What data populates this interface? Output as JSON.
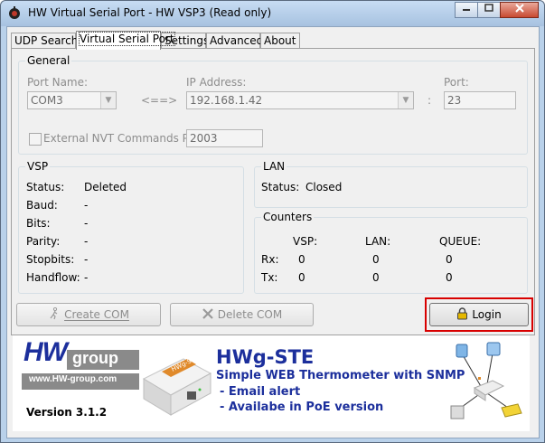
{
  "window": {
    "title": "HW Virtual Serial Port - HW VSP3 (Read only)"
  },
  "tabs": [
    {
      "label": "UDP Search"
    },
    {
      "label": "Virtual Serial Port",
      "active": true
    },
    {
      "label": "Settings"
    },
    {
      "label": "Advanced"
    },
    {
      "label": "About"
    }
  ],
  "general": {
    "title": "General",
    "port_name_label": "Port Name:",
    "port_name_value": "COM3",
    "arrow": "<==>",
    "ip_label": "IP Address:",
    "ip_value": "192.168.1.42",
    "colon": ":",
    "port_label": "Port:",
    "port_value": "23",
    "nvt_label": "External NVT Commands Port:",
    "nvt_value": "2003"
  },
  "vsp": {
    "title": "VSP",
    "rows": [
      {
        "label": "Status:",
        "value": "Deleted"
      },
      {
        "label": "Baud:",
        "value": "-"
      },
      {
        "label": "Bits:",
        "value": "-"
      },
      {
        "label": "Parity:",
        "value": "-"
      },
      {
        "label": "Stopbits:",
        "value": "-"
      },
      {
        "label": "Handflow:",
        "value": "-"
      }
    ]
  },
  "lan": {
    "title": "LAN",
    "status_label": "Status:",
    "status_value": "Closed"
  },
  "counters": {
    "title": "Counters",
    "headers": [
      "VSP:",
      "LAN:",
      "QUEUE:"
    ],
    "rows": [
      {
        "label": "Rx:",
        "values": [
          "0",
          "0",
          "0"
        ]
      },
      {
        "label": "Tx:",
        "values": [
          "0",
          "0",
          "0"
        ]
      }
    ]
  },
  "buttons": {
    "create_com": "Create COM",
    "delete_com": "Delete COM",
    "login": "Login"
  },
  "banner": {
    "logo_hw": "HW",
    "logo_group": "group",
    "logo_url": "www.HW-group.com",
    "version": "Version  3.1.2",
    "product_title": "HWg-STE",
    "product_subtitle": "Simple WEB Thermometer with SNMP",
    "bullet1": "- Email alert",
    "bullet2": "- Availabe in PoE version",
    "device_label": "HWg-STE"
  },
  "colors": {
    "banner_blue": "#1c2f9c",
    "highlight": "#d80000",
    "logo_gray": "#8a8a8a"
  }
}
